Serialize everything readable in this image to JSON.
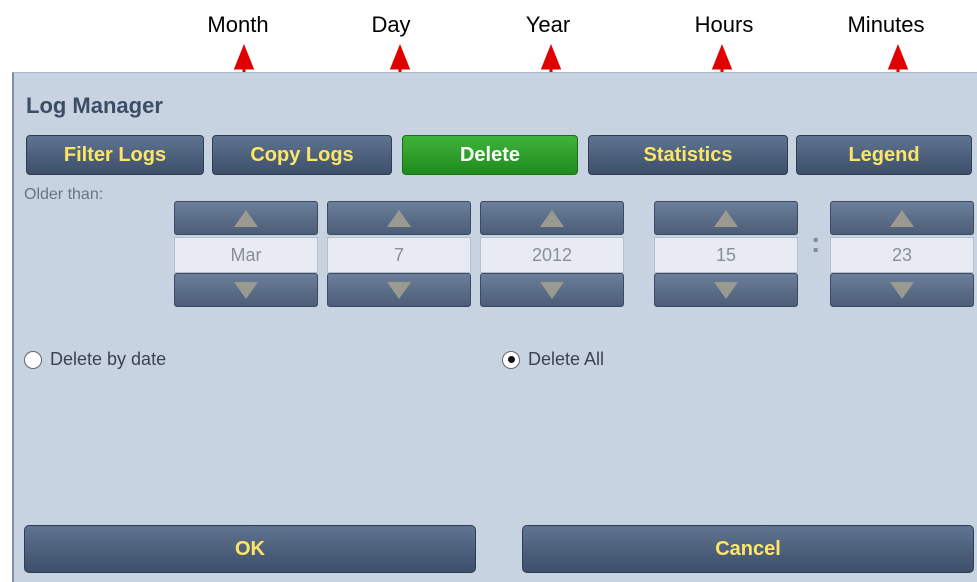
{
  "annotations": {
    "month": "Month",
    "day": "Day",
    "year": "Year",
    "hours": "Hours",
    "minutes": "Minutes"
  },
  "window": {
    "title": "Log Manager"
  },
  "tabs": [
    {
      "label": "Filter Logs"
    },
    {
      "label": "Copy Logs"
    },
    {
      "label": "Delete"
    },
    {
      "label": "Statistics"
    },
    {
      "label": "Legend"
    }
  ],
  "older_than_label": "Older than:",
  "spinners": {
    "month": "Mar",
    "day": "7",
    "year": "2012",
    "hours": "15",
    "minutes": "23"
  },
  "time_separator": ":",
  "options": {
    "delete_by_date": "Delete by date",
    "delete_all": "Delete All",
    "selected": "Delete All"
  },
  "buttons": {
    "ok": "OK",
    "cancel": "Cancel"
  },
  "colors": {
    "arrow": "#e00000",
    "active_tab": "#2a9e27",
    "button_text": "#ffe566",
    "panel_bg": "#c8d3e1"
  }
}
